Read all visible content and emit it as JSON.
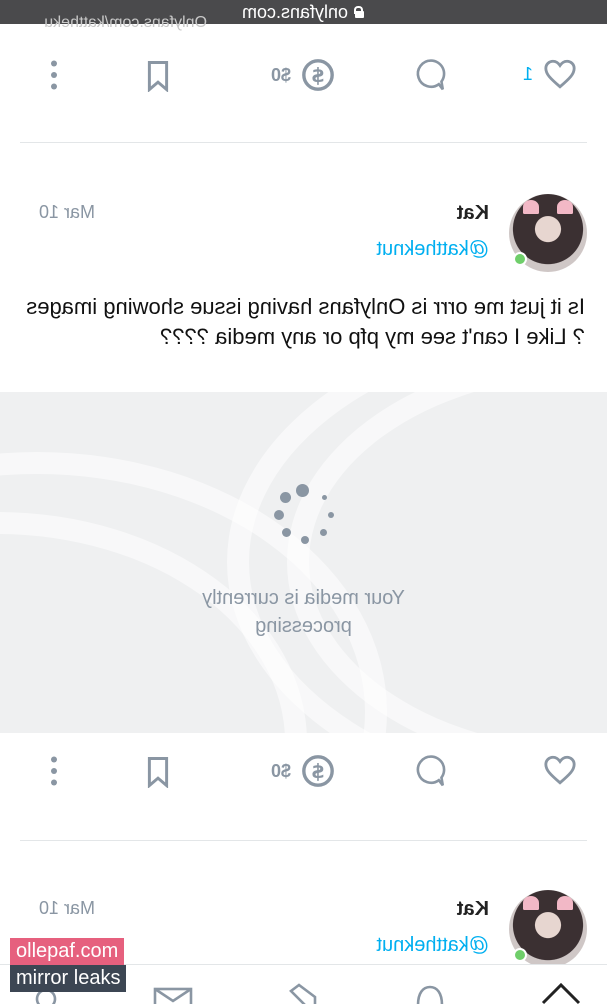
{
  "browser": {
    "url": "onlyfans.com"
  },
  "feed": {
    "ghost_text": "Onlyfans.com/kattheku",
    "post_prev": {
      "likes": "1",
      "tip_label": "$0"
    },
    "post_main": {
      "name": "Kat",
      "handle": "@kattheknut",
      "date": "Mar 10",
      "text": "Is it just me orrr is Onlyfans having issue showing images ? Like I can't see my pfp or any media ????",
      "media_status": "Your media is currently processing",
      "tip_label": "$0"
    },
    "post_next": {
      "name": "Kat",
      "handle": "@kattheknut",
      "date": "Mar 10"
    }
  },
  "icons": [
    "heart-icon",
    "comment-icon",
    "dollar-icon",
    "bookmark-icon",
    "more-icon",
    "home-icon",
    "mail-icon",
    "add-post-icon",
    "notifications-icon",
    "lock-icon"
  ],
  "watermark": {
    "line1": "ollepaf.com",
    "line2": "mirror leaks"
  },
  "colors": {
    "accent": "#00aff0",
    "muted": "#8a96a3",
    "online": "#6fce6a"
  }
}
